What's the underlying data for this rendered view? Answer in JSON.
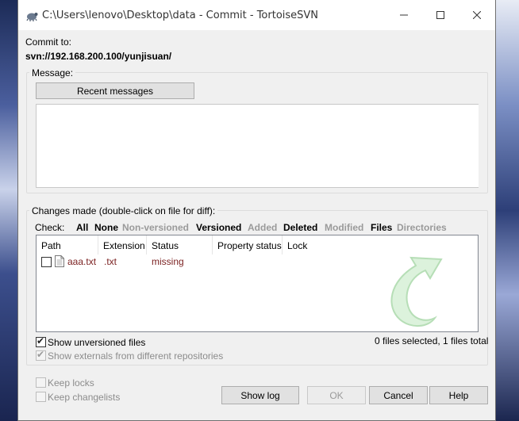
{
  "window": {
    "title": "C:\\Users\\lenovo\\Desktop\\data - Commit - TortoiseSVN",
    "controls": {
      "minimize": "minimize",
      "maximize": "maximize",
      "close": "close"
    }
  },
  "commit_to": {
    "label": "Commit to:",
    "url": "svn://192.168.200.100/yunjisuan/"
  },
  "message": {
    "group_label": "Message:",
    "recent_button": "Recent messages",
    "text": ""
  },
  "changes": {
    "group_label": "Changes made (double-click on file for diff):",
    "check_label": "Check:",
    "filters": [
      {
        "label": "All",
        "active": true
      },
      {
        "label": "None",
        "active": true
      },
      {
        "label": "Non-versioned",
        "active": false
      },
      {
        "label": "Versioned",
        "active": true
      },
      {
        "label": "Added",
        "active": false
      },
      {
        "label": "Deleted",
        "active": true
      },
      {
        "label": "Modified",
        "active": false
      },
      {
        "label": "Files",
        "active": true
      },
      {
        "label": "Directories",
        "active": false
      }
    ],
    "columns": [
      "Path",
      "Extension",
      "Status",
      "Property status",
      "Lock"
    ],
    "rows": [
      {
        "checked": false,
        "path": "aaa.txt",
        "extension": ".txt",
        "status": "missing",
        "property_status": "",
        "lock": ""
      }
    ],
    "show_unversioned": {
      "label": "Show unversioned files",
      "checked": true
    },
    "show_externals": {
      "label": "Show externals from different repositories",
      "checked": true,
      "enabled": false
    },
    "selection_summary": "0 files selected, 1 files total"
  },
  "options": {
    "keep_locks": {
      "label": "Keep locks",
      "checked": false,
      "enabled": false
    },
    "keep_changelists": {
      "label": "Keep changelists",
      "checked": false,
      "enabled": false
    }
  },
  "buttons": {
    "show_log": "Show log",
    "ok": "OK",
    "cancel": "Cancel",
    "help": "Help"
  },
  "colors": {
    "missing_status": "#7a1f1f",
    "disabled_text": "#9a9a9a"
  }
}
